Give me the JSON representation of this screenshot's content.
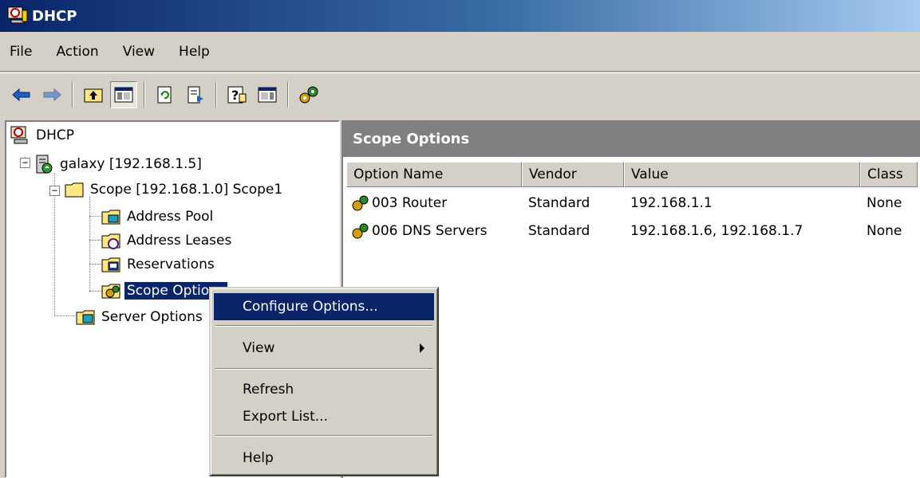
{
  "window": {
    "title": "DHCP"
  },
  "menu": [
    "File",
    "Action",
    "View",
    "Help"
  ],
  "toolbar": {
    "buttons": [
      "back-icon",
      "forward-icon",
      "up-folder-icon",
      "show-hide-tree-icon",
      "refresh-icon",
      "export-list-icon",
      "help-icon",
      "show-hide-action-pane-icon",
      "scope-options-icon"
    ]
  },
  "tree": {
    "root": "DHCP",
    "server": "galaxy [192.168.1.5]",
    "scope": "Scope [192.168.1.0] Scope1",
    "children": [
      "Address Pool",
      "Address Leases",
      "Reservations",
      "Scope Options"
    ],
    "server_options": "Server Options"
  },
  "detail": {
    "title": "Scope Options",
    "columns": [
      "Option Name",
      "Vendor",
      "Value",
      "Class"
    ],
    "rows": [
      {
        "name": "003 Router",
        "vendor": "Standard",
        "value": "192.168.1.1",
        "class": "None"
      },
      {
        "name": "006 DNS Servers",
        "vendor": "Standard",
        "value": "192.168.1.6, 192.168.1.7",
        "class": "None"
      }
    ]
  },
  "context_menu": {
    "items": [
      "Configure Options...",
      "View",
      "Refresh",
      "Export List...",
      "Help"
    ],
    "highlighted": "Configure Options..."
  },
  "colors": {
    "selection": "#0a246a",
    "face": "#d4d0c8",
    "header": "#808080"
  }
}
